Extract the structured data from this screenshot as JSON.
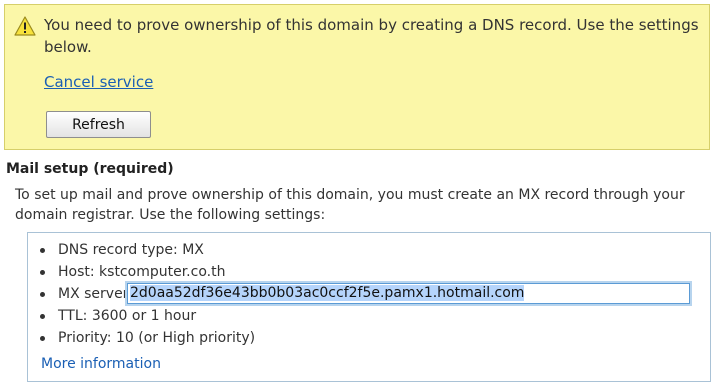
{
  "alert": {
    "message": "You need to prove ownership of this domain by creating a DNS record. Use the settings below.",
    "cancel_link": "Cancel service",
    "refresh_button": "Refresh",
    "icon": "warning-icon"
  },
  "mail_setup": {
    "title": "Mail setup (required)",
    "description": "To set up mail and prove ownership of this domain, you must create an MX record through your domain registrar. Use the following settings:",
    "settings": {
      "record_type": "DNS record type: MX",
      "host": "Host: kstcomputer.co.th",
      "mx_label": "MX server:",
      "mx_value": "2d0aa52df36e43bb0b03ac0ccf2f5e.pamx1.hotmail.com",
      "ttl": "TTL: 3600 or 1 hour",
      "priority": "Priority: 10 (or High priority)"
    },
    "more_info_link": "More information"
  },
  "colors": {
    "alert_background": "#fbf7a8",
    "link": "#1a5fb4",
    "selection": "#b5d4fb"
  }
}
